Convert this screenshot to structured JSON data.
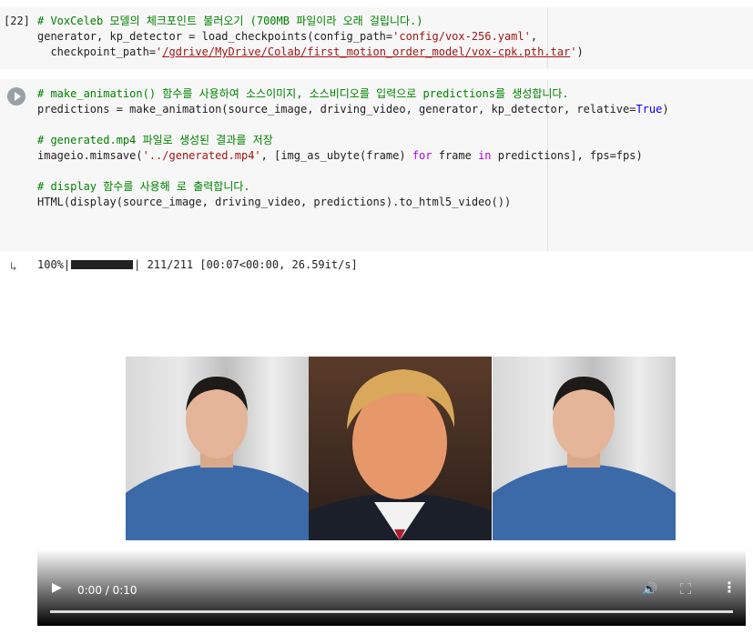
{
  "cell1": {
    "exec_count": "[22]",
    "lines": {
      "l1_comment": "# VoxCeleb 모델의 체크포인트 불러오기 (700MB 파일이라 오래 걸립니다.)",
      "l2_a": "generator, kp_detector = load_checkpoints(config_path=",
      "l2_str": "'config/vox-256.yaml'",
      "l2_b": ",",
      "l3_a": "  checkpoint_path=",
      "l3_q1": "'",
      "l3_link": "/gdrive/MyDrive/Colab/first_motion_order_model/vox-cpk.pth.tar",
      "l3_q2": "'",
      "l3_b": ")"
    }
  },
  "cell2": {
    "run_icon": "play-circle-icon",
    "lines": {
      "c1": "# make_animation() 함수를 사용하여 소스이미지, 소스비디오를 입력으로 predictions를 생성합니다.",
      "l1_a": "predictions = make_animation(source_image, driving_video, generator, kp_detector, relative=",
      "l1_kw": "True",
      "l1_b": ")",
      "c2": "# generated.mp4 파일로 생성된 결과를 저장",
      "l2_a": "imageio.mimsave(",
      "l2_str": "'../generated.mp4'",
      "l2_b": ", [img_as_ubyte(frame) ",
      "l2_for": "for",
      "l2_c": " frame ",
      "l2_in": "in",
      "l2_d": " predictions], fps=fps)",
      "c3": "# display 함수를 사용해 로 출력합니다.",
      "l3": "HTML(display(source_image, driving_video, predictions).to_html5_video())"
    }
  },
  "output": {
    "icon": "output-arrow-icon",
    "progress_pct": "100%|",
    "progress_fraction": 1.0,
    "progress_rest": "| 211/211 [00:07<00:00, 26.59it/s]"
  },
  "video": {
    "time": "0:00 / 0:10",
    "icons": [
      "play-icon",
      "volume-icon",
      "fullscreen-icon",
      "more-options-icon"
    ],
    "frames": [
      "source-image",
      "driving-video-frame",
      "prediction-frame"
    ]
  }
}
